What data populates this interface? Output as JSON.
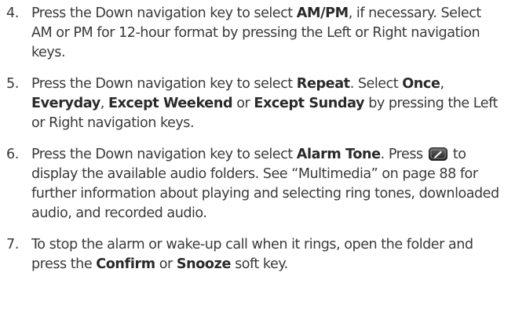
{
  "steps": [
    {
      "number": "4.",
      "t1": "Press the Down navigation key to select ",
      "b1": "AM/PM",
      "t2": ", if necessary. Select AM or PM for 12-hour format by pressing the Left or Right navigation keys."
    },
    {
      "number": "5.",
      "t1": "Press the Down navigation key to select ",
      "b1": "Repeat",
      "t2": ". Select ",
      "b2": "Once",
      "t3": ", ",
      "b3": "Everyday",
      "t4": ", ",
      "b4": "Except Weekend",
      "t5": " or ",
      "b5": "Except Sunday",
      "t6": " by pressing the Left or Right navigation keys."
    },
    {
      "number": "6.",
      "t1": "Press the Down navigation key to select ",
      "b1": "Alarm Tone",
      "t2": ". Press ",
      "icon": "ok-key-icon",
      "t3": " to display the available audio folders. See “Multimedia” on page 88 for further information about playing and selecting ring tones, downloaded audio, and recorded audio."
    },
    {
      "number": "7.",
      "t1": "To stop the alarm or wake-up call when it rings, open the folder and press the ",
      "b1": "Confirm",
      "t2": " or ",
      "b2": "Snooze",
      "t3": " soft key."
    }
  ]
}
